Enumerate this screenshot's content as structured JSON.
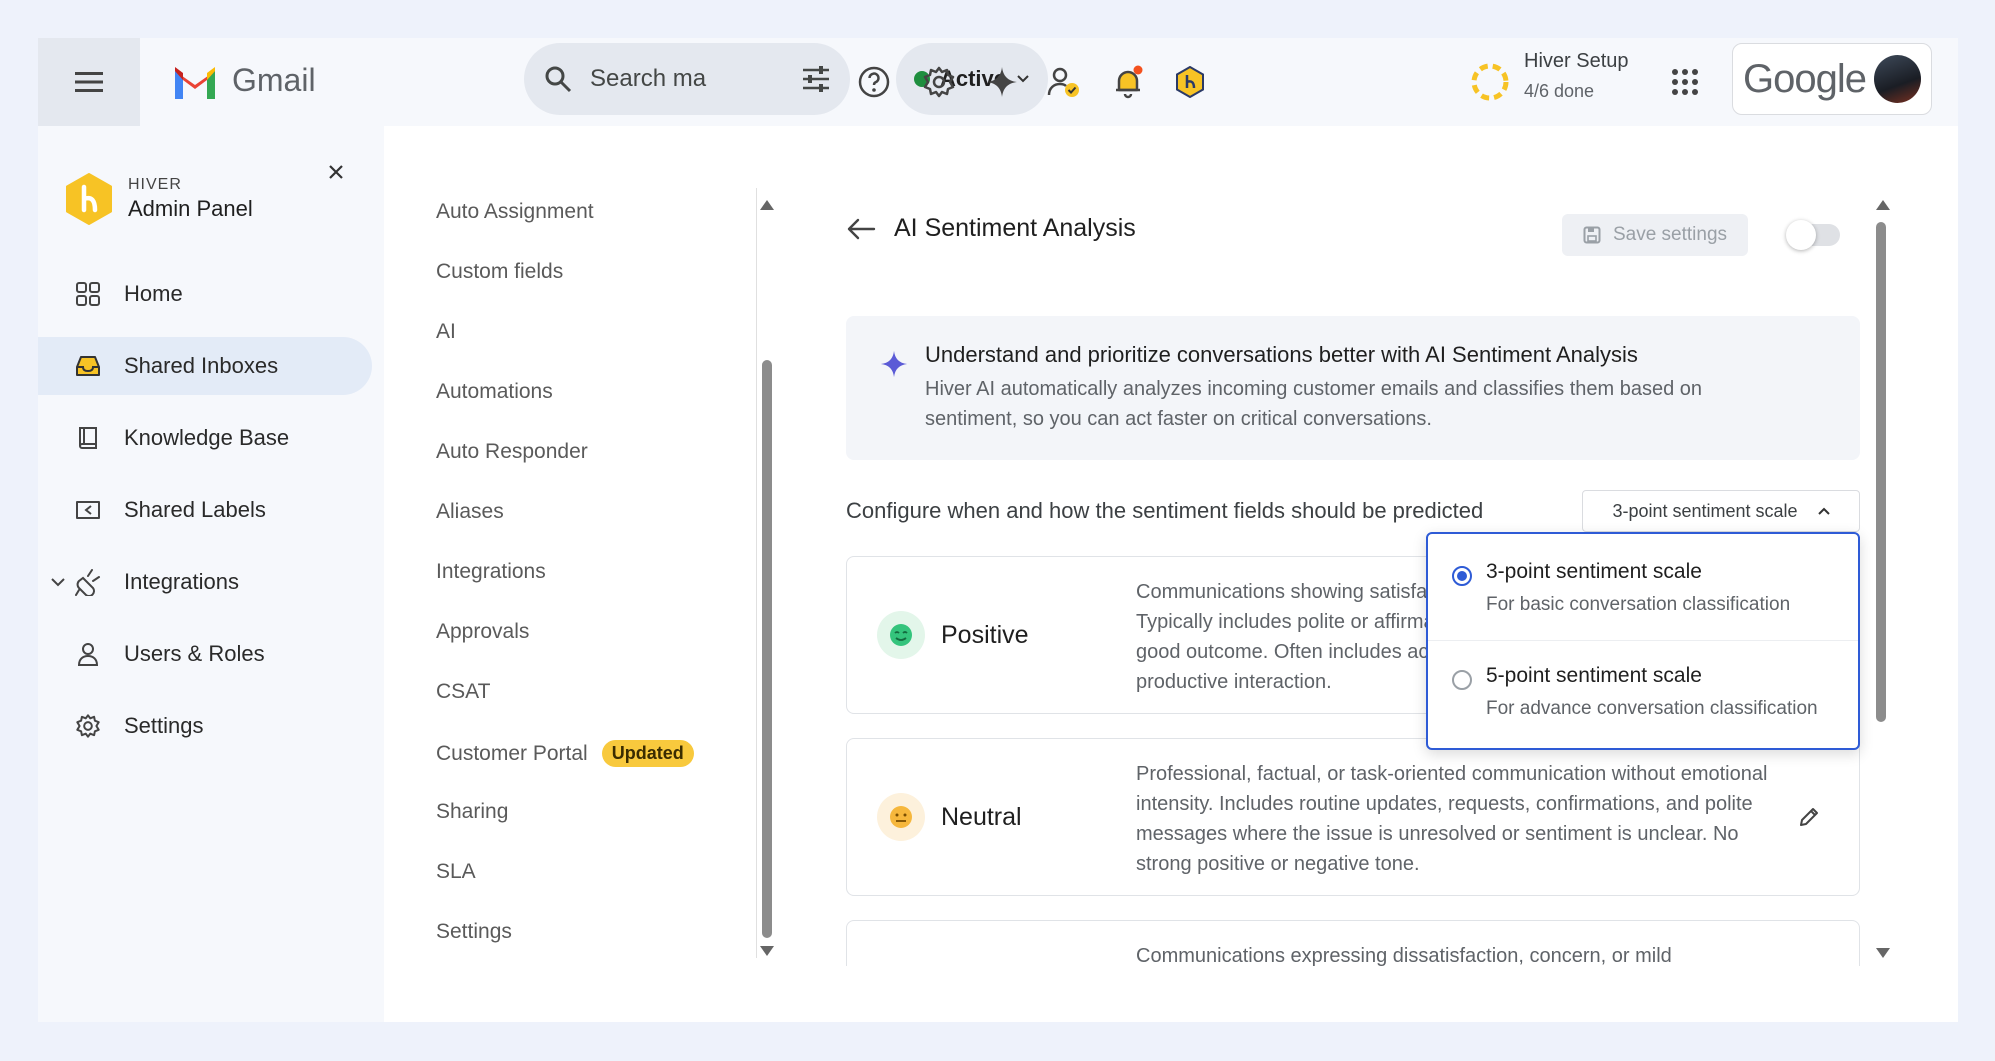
{
  "gmail": {
    "app_name": "Gmail",
    "search_placeholder": "Search ma",
    "status_label": "Active",
    "setup_title": "Hiver Setup",
    "setup_progress": "4/6 done",
    "account_brand": "Google"
  },
  "sidebar": {
    "brand_small": "HIVER",
    "brand_big": "Admin Panel",
    "items": [
      {
        "label": "Home",
        "icon": "grid-icon"
      },
      {
        "label": "Shared Inboxes",
        "icon": "inbox-icon",
        "active": true
      },
      {
        "label": "Knowledge Base",
        "icon": "book-icon"
      },
      {
        "label": "Shared Labels",
        "icon": "label-icon"
      },
      {
        "label": "Integrations",
        "icon": "plug-icon"
      },
      {
        "label": "Users & Roles",
        "icon": "user-icon"
      },
      {
        "label": "Settings",
        "icon": "gear-icon"
      }
    ]
  },
  "submenu": {
    "items": [
      {
        "label": "Auto Assignment"
      },
      {
        "label": "Custom fields"
      },
      {
        "label": "AI"
      },
      {
        "label": "Automations"
      },
      {
        "label": "Auto Responder"
      },
      {
        "label": "Aliases"
      },
      {
        "label": "Integrations"
      },
      {
        "label": "Approvals"
      },
      {
        "label": "CSAT"
      },
      {
        "label": "Customer Portal",
        "badge": "Updated"
      },
      {
        "label": "Sharing"
      },
      {
        "label": "SLA"
      },
      {
        "label": "Settings"
      }
    ]
  },
  "page": {
    "title": "AI Sentiment Analysis",
    "save_label": "Save settings",
    "toggle_on": false,
    "info_title": "Understand and prioritize conversations better with AI Sentiment Analysis",
    "info_desc": "Hiver AI automatically analyzes incoming customer emails and classifies them based on sentiment, so you can act faster on critical conversations.",
    "config_label": "Configure when and how the sentiment fields should be predicted",
    "scale_selected": "3-point sentiment scale",
    "cards": [
      {
        "name": "Positive",
        "desc": "Communications showing satisfaction, appreciation, or approval. Typically includes polite or affirmative language tied to a resolution or a good outcome. Often includes acknowledgment of helpful service or productive interaction."
      },
      {
        "name": "Neutral",
        "desc": "Professional, factual, or task-oriented communication without emotional intensity. Includes routine updates, requests, confirmations, and polite messages where the issue is unresolved or sentiment is unclear. No strong positive or negative tone."
      },
      {
        "name": "",
        "desc": "Communications expressing dissatisfaction, concern, or mild"
      }
    ]
  },
  "dropdown": {
    "options": [
      {
        "title": "3-point sentiment scale",
        "sub": "For basic conversation classification",
        "selected": true
      },
      {
        "title": "5-point sentiment scale",
        "sub": "For advance conversation classification",
        "selected": false
      }
    ]
  },
  "colors": {
    "accent": "#2e5bd6",
    "active_green": "#1e8e3e",
    "badge_yellow": "#f8c93d",
    "hiver_yellow": "#f7c325",
    "ai_star": "#5b5bd6"
  }
}
